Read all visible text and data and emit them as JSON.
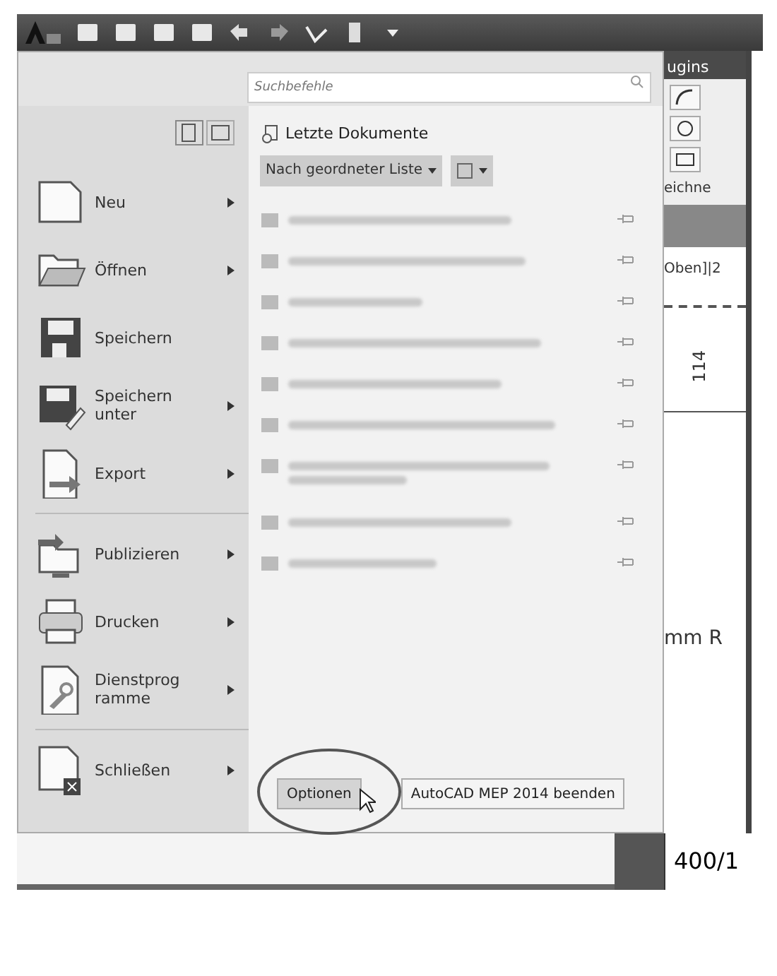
{
  "search": {
    "placeholder": "Suchbefehle"
  },
  "recent": {
    "title": "Letzte Dokumente",
    "sort": "Nach geordneter Liste"
  },
  "menu": [
    {
      "lines": [
        "Neu"
      ],
      "submenu": true,
      "divider_after": false
    },
    {
      "lines": [
        "Öffnen"
      ],
      "submenu": true,
      "divider_after": false
    },
    {
      "lines": [
        "Speichern"
      ],
      "submenu": false,
      "divider_after": false
    },
    {
      "lines": [
        "Speichern",
        "unter"
      ],
      "submenu": true,
      "divider_after": false
    },
    {
      "lines": [
        "Export"
      ],
      "submenu": true,
      "divider_after": true
    },
    {
      "lines": [
        "Publizieren"
      ],
      "submenu": true,
      "divider_after": false
    },
    {
      "lines": [
        "Drucken"
      ],
      "submenu": true,
      "divider_after": false
    },
    {
      "lines": [
        "Dienstprog",
        "ramme"
      ],
      "submenu": true,
      "divider_after": true
    },
    {
      "lines": [
        "Schließen"
      ],
      "submenu": true,
      "divider_after": false
    }
  ],
  "documents": [
    {
      "kind": "single"
    },
    {
      "kind": "single"
    },
    {
      "kind": "single"
    },
    {
      "kind": "single"
    },
    {
      "kind": "single"
    },
    {
      "kind": "single"
    },
    {
      "kind": "double"
    },
    {
      "kind": "single"
    },
    {
      "kind": "single"
    }
  ],
  "buttons": [
    {
      "label": "Optionen",
      "highlighted": true
    },
    {
      "label": "AutoCAD MEP 2014 beenden",
      "highlighted": false
    }
  ],
  "background": {
    "tab": "ugins",
    "panel": "eichne",
    "view": "Oben]|2",
    "dim": "114",
    "note": "mm R",
    "scale": "400/1"
  }
}
